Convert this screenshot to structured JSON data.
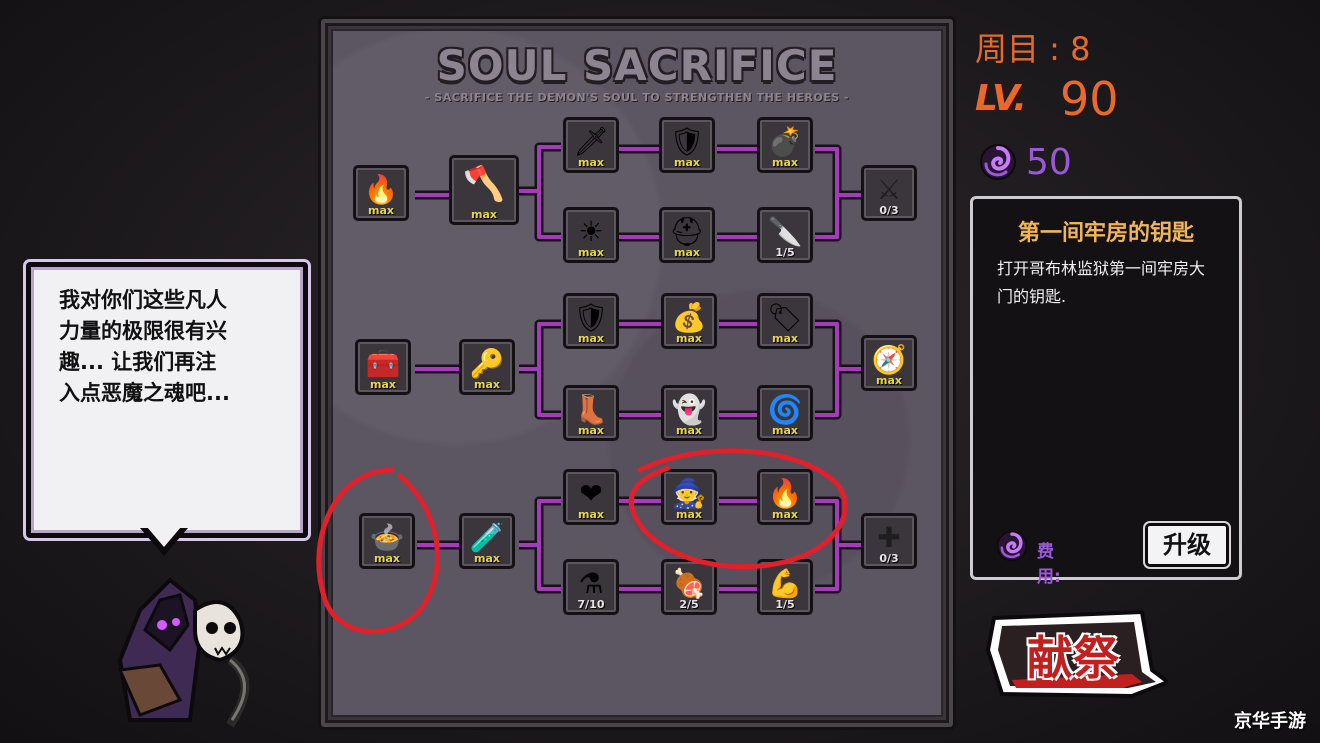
{
  "board": {
    "title": "SOUL SACRIFICE",
    "subtitle": "- SACRIFICE THE DEMON'S SOUL TO STRENGTHEN THE HEROES -",
    "nodes": [
      {
        "id": "n1",
        "icon": "anvil-icon",
        "glyph": "🔥",
        "label": "max"
      },
      {
        "id": "n2",
        "icon": "axe-icon",
        "glyph": "🪓",
        "label": "max"
      },
      {
        "id": "n3",
        "icon": "sword-up-icon",
        "glyph": "🗡",
        "label": "max"
      },
      {
        "id": "n4",
        "icon": "knight-icon",
        "glyph": "🛡",
        "label": "max"
      },
      {
        "id": "n5",
        "icon": "bomb-icon",
        "glyph": "💣",
        "label": "max"
      },
      {
        "id": "n6",
        "icon": "crossed-axes-icon",
        "glyph": "⚔",
        "label": "0/3"
      },
      {
        "id": "n7",
        "icon": "sun-up-icon",
        "glyph": "☀",
        "label": "max"
      },
      {
        "id": "n8",
        "icon": "helmet-icon",
        "glyph": "⛑",
        "label": "max"
      },
      {
        "id": "n9",
        "icon": "dagger-icon",
        "glyph": "🔪",
        "label": "1/5"
      },
      {
        "id": "n10",
        "icon": "chest-icon",
        "glyph": "🧰",
        "label": "max"
      },
      {
        "id": "n11",
        "icon": "key-icon",
        "glyph": "🔑",
        "label": "max"
      },
      {
        "id": "n12",
        "icon": "shield-up-icon",
        "glyph": "🛡",
        "label": "max"
      },
      {
        "id": "n13",
        "icon": "treasure-icon",
        "glyph": "💰",
        "label": "max"
      },
      {
        "id": "n14",
        "icon": "sale-icon",
        "glyph": "🏷",
        "label": "max"
      },
      {
        "id": "n15",
        "icon": "compass-icon",
        "glyph": "🧭",
        "label": "max"
      },
      {
        "id": "n16",
        "icon": "winged-boot-icon",
        "glyph": "👢",
        "label": "max"
      },
      {
        "id": "n17",
        "icon": "ghost-icon",
        "glyph": "👻",
        "label": "max"
      },
      {
        "id": "n18",
        "icon": "purple-swirl-icon",
        "glyph": "🌀",
        "label": "max"
      },
      {
        "id": "n19",
        "icon": "cauldron-icon",
        "glyph": "🍲",
        "label": "max"
      },
      {
        "id": "n20",
        "icon": "wand-icon",
        "glyph": "🧪",
        "label": "max"
      },
      {
        "id": "n21",
        "icon": "heart-up-icon",
        "glyph": "❤",
        "label": "max"
      },
      {
        "id": "n22",
        "icon": "hooded-figure-icon",
        "glyph": "🧙",
        "label": "max"
      },
      {
        "id": "n23",
        "icon": "golden-flame-icon",
        "glyph": "🔥",
        "label": "max"
      },
      {
        "id": "n24",
        "icon": "cross-icon",
        "glyph": "✚",
        "label": "0/3"
      },
      {
        "id": "n25",
        "icon": "red-potion-icon",
        "glyph": "⚗",
        "label": "7/10"
      },
      {
        "id": "n26",
        "icon": "meat-icon",
        "glyph": "🍖",
        "label": "2/5"
      },
      {
        "id": "n27",
        "icon": "arm-bandage-icon",
        "glyph": "💪",
        "label": "1/5"
      }
    ]
  },
  "bubble": {
    "lines": [
      "我对你们这些凡人",
      "力量的极限很有兴",
      "趣... 让我们再注",
      "入点恶魔之魂吧..."
    ]
  },
  "status": {
    "round": "周目 : 8",
    "lv_prefix": "LV.",
    "level": "90",
    "souls": "50"
  },
  "info": {
    "title": "第一间牢房的钥匙",
    "description": "打开哥布林监狱第一间牢房大门的钥匙.",
    "cost_label": "费用:",
    "upgrade_label": "升级"
  },
  "actions": {
    "sacrifice_label": "献祭"
  },
  "watermark": "京华手游",
  "colors": {
    "accent": "#e8692c",
    "soul": "#9a5ad6",
    "connector": "#a43bb7",
    "max_text": "#e8d64a",
    "annotation": "#e0202a"
  }
}
